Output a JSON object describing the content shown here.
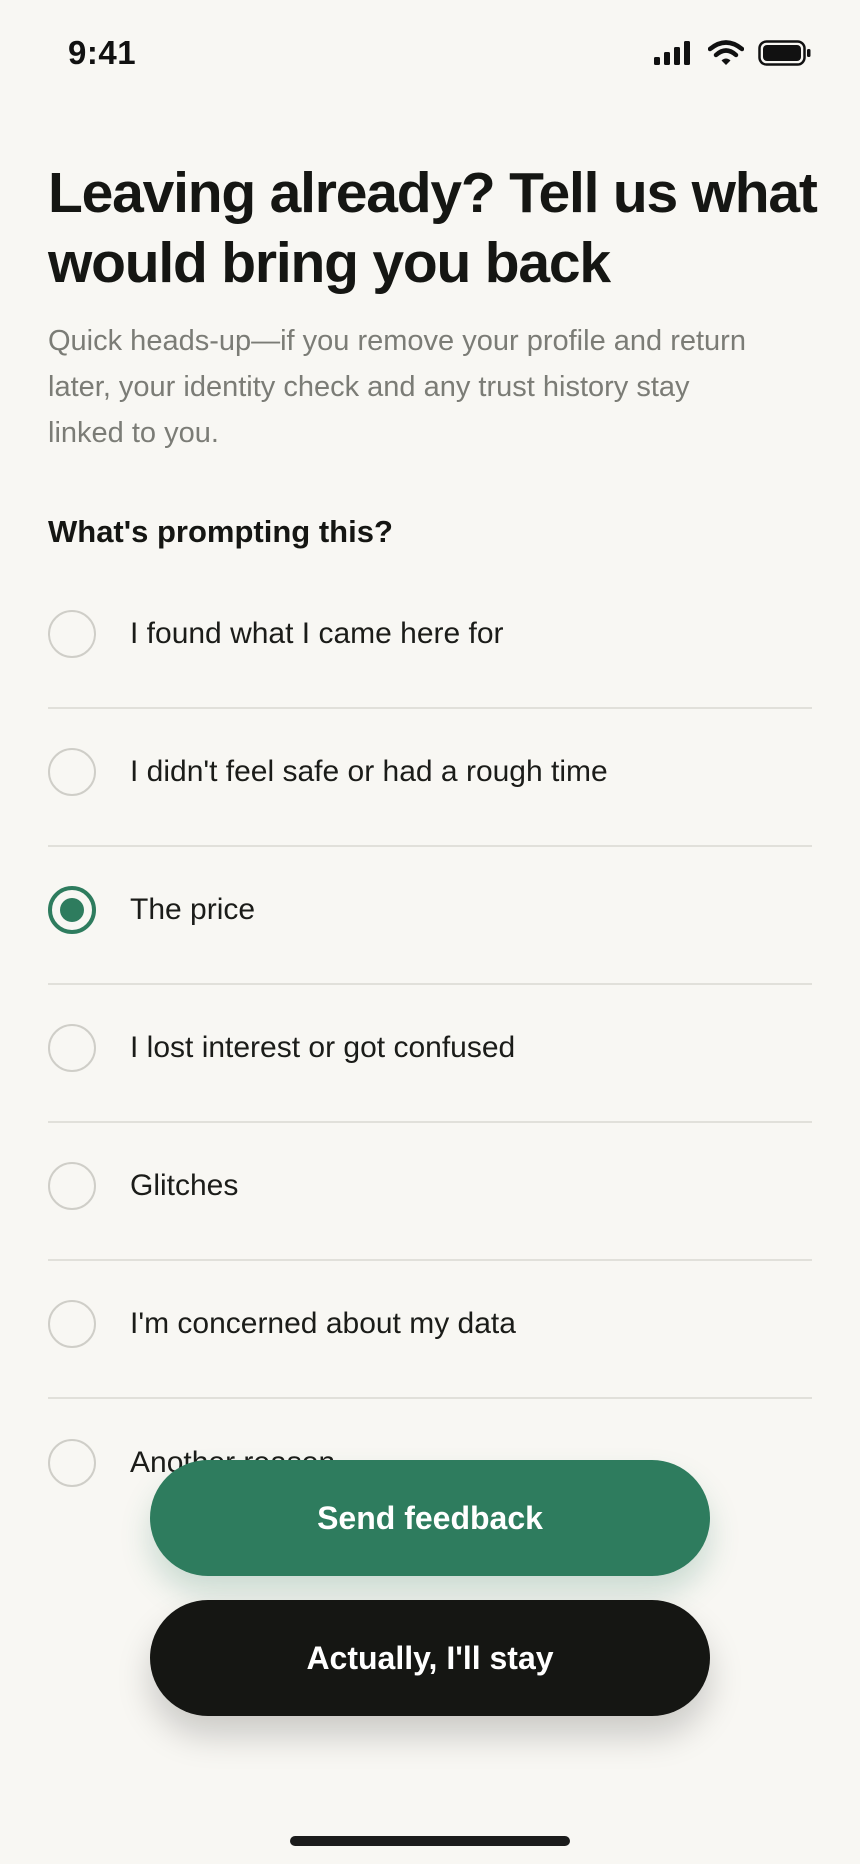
{
  "status_bar": {
    "time": "9:41",
    "icons": [
      "cellular-signal-icon",
      "wifi-icon",
      "battery-icon"
    ]
  },
  "header": {
    "title": "Leaving already? Tell us what would bring you back",
    "subtitle": "Quick heads-up—if you remove your profile and return later, your identity check and any trust history stay linked to you."
  },
  "survey": {
    "question": "What's prompting this?",
    "selected_index": 2,
    "options": [
      {
        "label": "I found what I came here for",
        "selected": false
      },
      {
        "label": "I didn't feel safe or had a rough time",
        "selected": false
      },
      {
        "label": "The price",
        "selected": true
      },
      {
        "label": "I lost interest or got confused",
        "selected": false
      },
      {
        "label": "Glitches",
        "selected": false
      },
      {
        "label": "I'm concerned about my data",
        "selected": false
      },
      {
        "label": "Another reason",
        "selected": false
      }
    ]
  },
  "actions": {
    "send_label": "Send feedback",
    "stay_label": "Actually, I'll stay"
  },
  "colors": {
    "accent": "#2e7c5e",
    "primary_dark": "#151613",
    "background": "#f8f7f3",
    "muted_text": "#7b7c76",
    "divider": "#e1e0da"
  }
}
